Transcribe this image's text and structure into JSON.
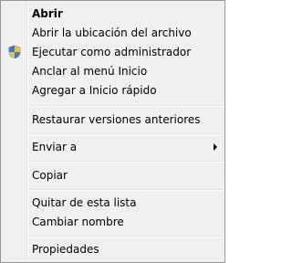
{
  "menu": {
    "items": [
      {
        "label": "Abrir"
      },
      {
        "label": "Abrir la ubicación del archivo"
      },
      {
        "label": "Ejecutar como administrador",
        "icon": "uac-shield-icon"
      },
      {
        "label": "Anclar al menú Inicio"
      },
      {
        "label": "Agregar a Inicio rápido"
      },
      {
        "label": "Restaurar versiones anteriores"
      },
      {
        "label": "Enviar a",
        "submenu": true
      },
      {
        "label": "Copiar"
      },
      {
        "label": "Quitar de esta lista"
      },
      {
        "label": "Cambiar nombre"
      },
      {
        "label": "Propiedades"
      }
    ]
  },
  "colors": {
    "background": "#f0f0f0",
    "border": "#979797",
    "separator": "#e0e0e0"
  }
}
